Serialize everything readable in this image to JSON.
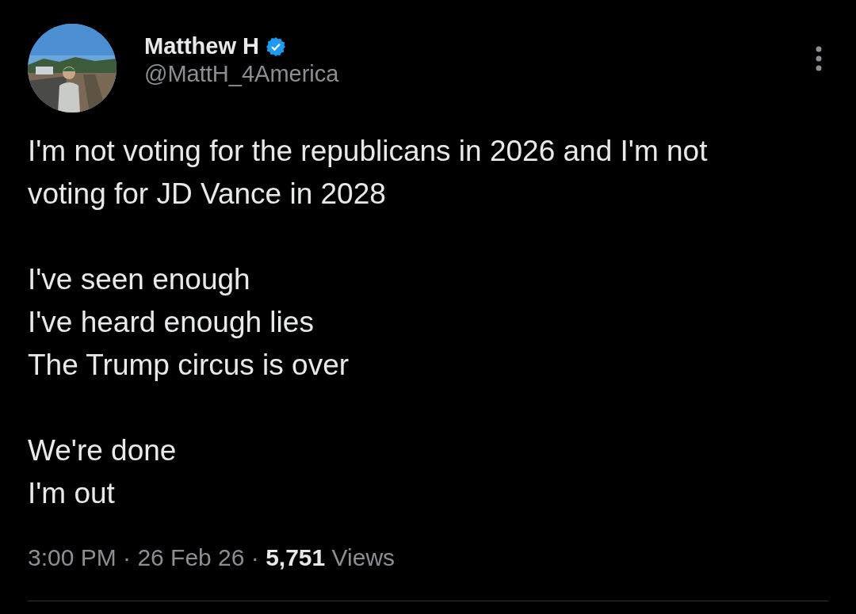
{
  "author": {
    "name": "Matthew H",
    "verified": true,
    "handle": "@MattH_4America"
  },
  "paragraphs": [
    "I'm not voting for the republicans in 2026 and I'm not voting for JD Vance in 2028",
    "I've seen enough\nI've heard enough lies\nThe Trump circus is over",
    "We're done\nI'm out"
  ],
  "meta": "3:00 PM · 26 Feb 26 · **5,751** Views"
}
